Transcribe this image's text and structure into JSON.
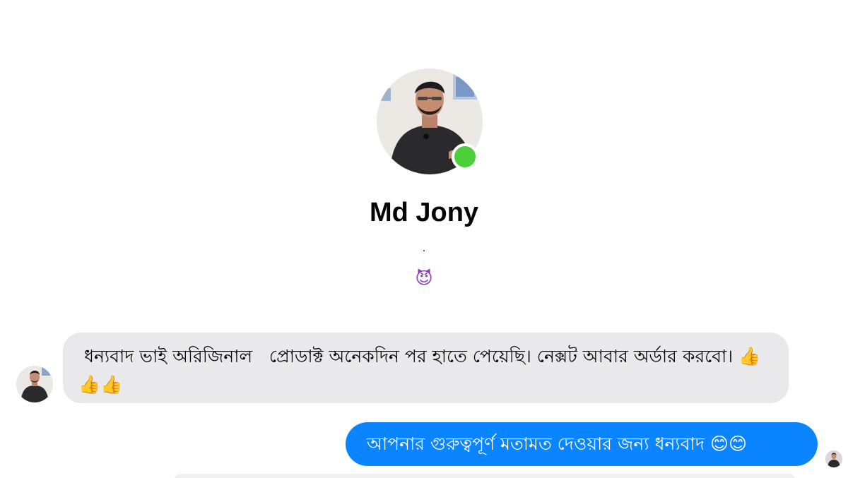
{
  "profile": {
    "name": "Md Jony",
    "bio_line": ".",
    "bio_emoji": "😈",
    "status": "online"
  },
  "messages": [
    {
      "direction": "incoming",
      "text": " ধন্যবাদ ভাই অরিজিনাল   প্রোডাক্ট অনেকদিন পর হাতে পেয়েছি। নেক্সট আবার অর্ডার করবো। 👍👍👍"
    },
    {
      "direction": "outgoing",
      "text": "আপনার গুরুত্বপূর্ণ মতামত দেওয়ার জন্য ধন্যবাদ  😊😊"
    }
  ],
  "colors": {
    "outgoing_bubble": "#0a84ff",
    "incoming_bubble": "#e9e9eb",
    "online_indicator": "#4cd03a",
    "background": "#ffffff"
  },
  "icons": {
    "online": "online-status-dot",
    "read_receipt": "read-receipt-avatar"
  }
}
